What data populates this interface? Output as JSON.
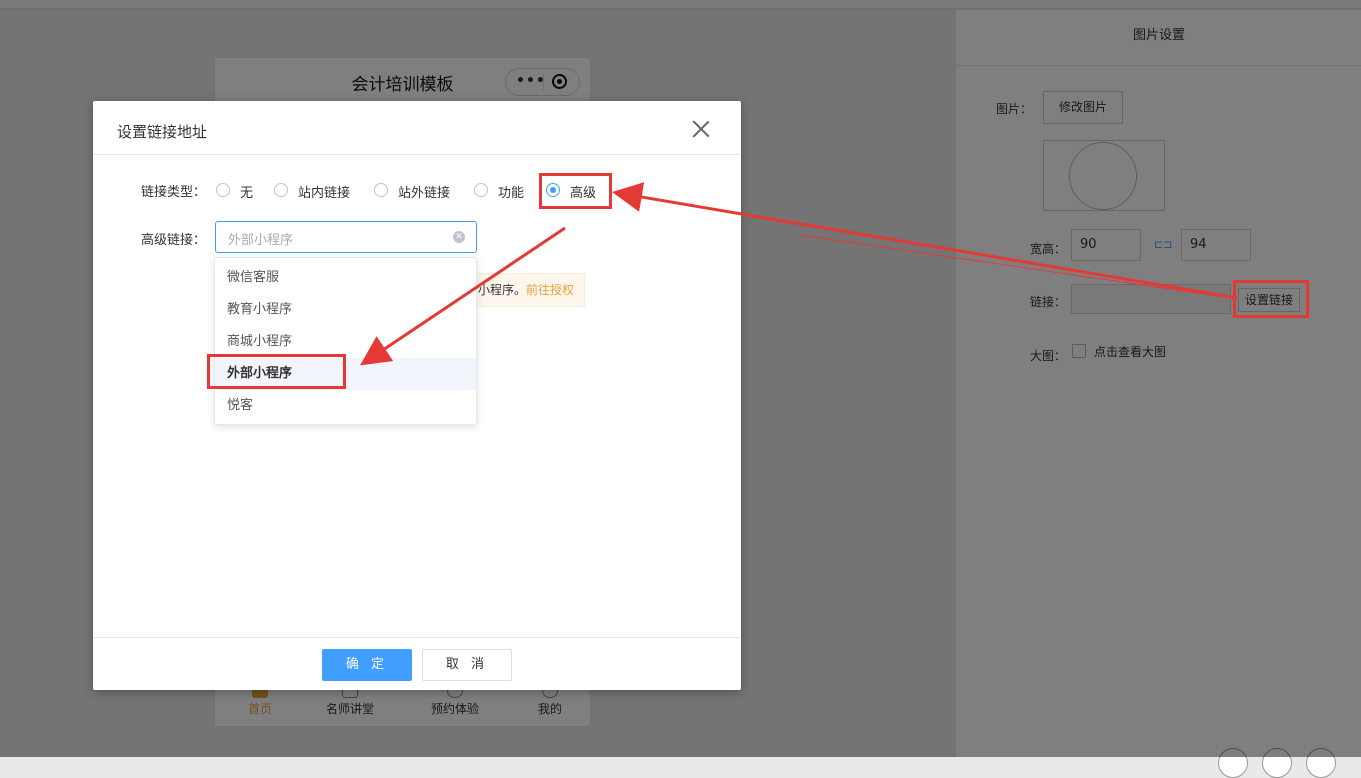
{
  "phone": {
    "title": "会计培训模板",
    "tabs": [
      "首页",
      "名师讲堂",
      "预约体验",
      "我的"
    ]
  },
  "panel": {
    "title": "图片设置",
    "image_label": "图片：",
    "edit_image_button": "修改图片",
    "size_label": "宽高：",
    "width_value": "90",
    "height_value": "94",
    "link_label": "链接：",
    "link_value": "",
    "set_link_button": "设置链接",
    "bigimg_label": "大图：",
    "bigimg_checkbox_label": "点击查看大图"
  },
  "dialog": {
    "title": "设置链接地址",
    "link_type_label": "链接类型：",
    "link_types": [
      "无",
      "站内链接",
      "站外链接",
      "功能",
      "高级"
    ],
    "selected_link_type": "高级",
    "advanced_label": "高级链接：",
    "advanced_placeholder": "外部小程序",
    "options": [
      "微信客服",
      "教育小程序",
      "商城小程序",
      "外部小程序",
      "悦客"
    ],
    "selected_option": "外部小程序",
    "tip_text": "小程序。",
    "tip_link": "前往授权",
    "confirm_button": "确 定",
    "cancel_button": "取 消"
  },
  "colors": {
    "primary": "#409eff",
    "highlight": "#e53935",
    "warning": "#e6a23c"
  }
}
